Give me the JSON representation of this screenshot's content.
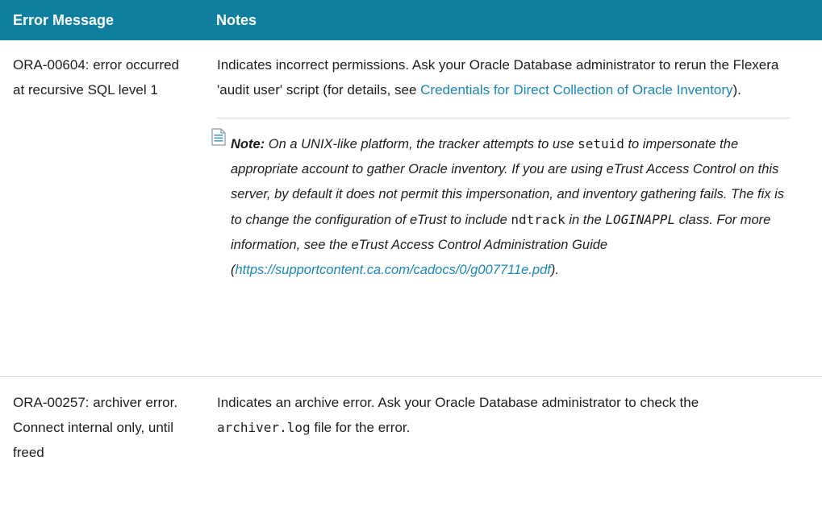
{
  "table": {
    "headers": [
      "Error Message",
      "Notes"
    ],
    "rows": [
      {
        "error": "ORA-00604: error occurred at recursive SQL level 1",
        "notes_pre": "Indicates incorrect permissions. Ask your Oracle Database administrator to rerun the Flexera 'audit user' script (for details, see ",
        "notes_link": "Credentials for Direct Collection of Oracle Inventory",
        "notes_post": ").",
        "note": {
          "label": "Note:",
          "part1": "On a UNIX-like platform, the tracker attempts to use ",
          "code1": "setuid",
          "part2": " to impersonate the appropriate account to gather Oracle inventory. If you are using eTrust Access Control on this server, by default it does not permit this impersonation, and inventory gathering fails. The fix is to change the configuration of eTrust to include ",
          "code2": "ndtrack",
          "part3": " in the ",
          "code3": "LOGINAPPL",
          "part4": " class. For more information, see the eTrust Access Control Administration Guide (",
          "link": "https://supportcontent.ca.com/cadocs/0/g007711e.pdf",
          "part5": ").",
          "icon": "note-icon"
        }
      },
      {
        "error": "ORA-00257: archiver error. Connect internal only, until freed",
        "notes_pre": "Indicates an archive error. Ask your Oracle Database administrator to check the ",
        "notes_code": "archiver.log",
        "notes_post": " file for the error."
      }
    ]
  },
  "colors": {
    "header_bg": "#0f7f9f",
    "link": "#1a86b8",
    "rule": "#d6d6d6"
  }
}
